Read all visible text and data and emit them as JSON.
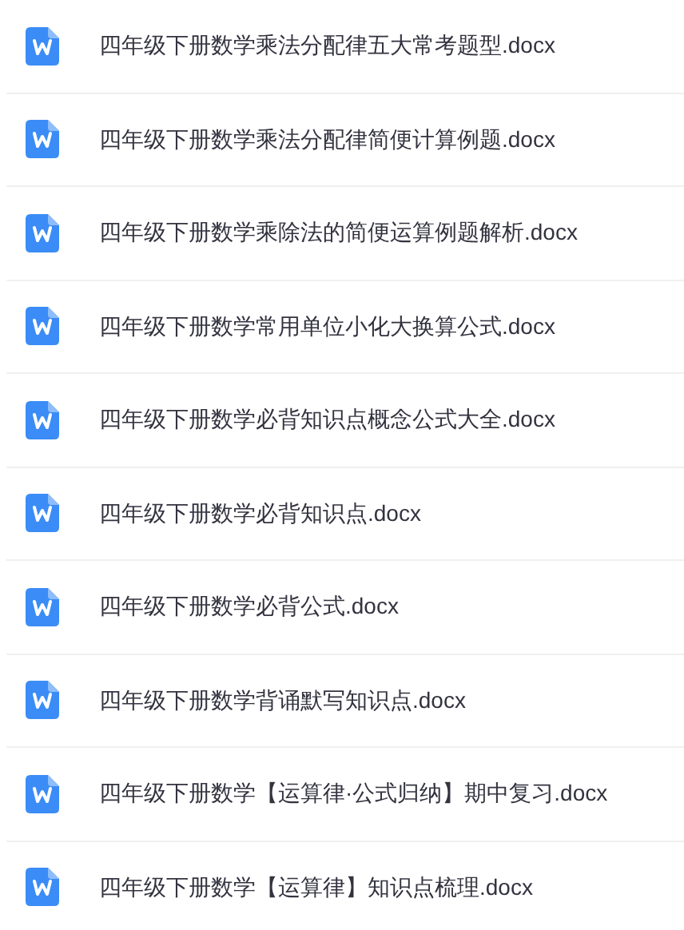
{
  "files": [
    {
      "name": "四年级下册数学乘法分配律五大常考题型.docx"
    },
    {
      "name": "四年级下册数学乘法分配律简便计算例题.docx"
    },
    {
      "name": "四年级下册数学乘除法的简便运算例题解析.docx"
    },
    {
      "name": "四年级下册数学常用单位小化大换算公式.docx"
    },
    {
      "name": "四年级下册数学必背知识点概念公式大全.docx"
    },
    {
      "name": "四年级下册数学必背知识点.docx"
    },
    {
      "name": "四年级下册数学必背公式.docx"
    },
    {
      "name": "四年级下册数学背诵默写知识点.docx"
    },
    {
      "name": "四年级下册数学【运算律·公式归纳】期中复习.docx"
    },
    {
      "name": "四年级下册数学【运算律】知识点梳理.docx"
    }
  ]
}
